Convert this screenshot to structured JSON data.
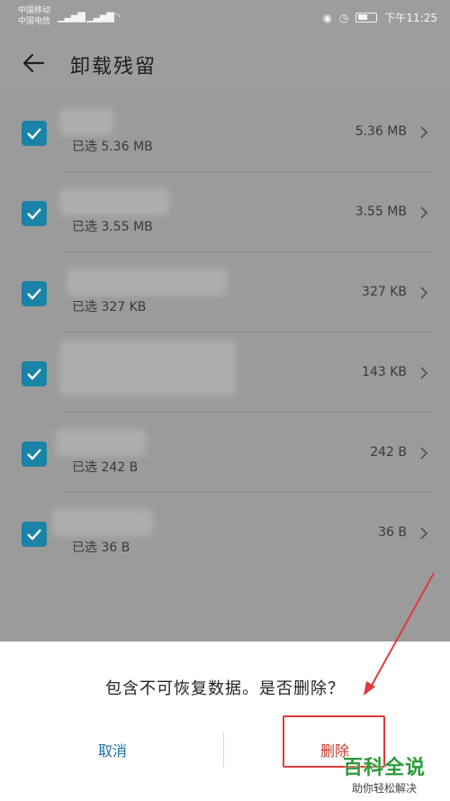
{
  "status_bar": {
    "carrier_1": "中国移动",
    "carrier_2": "中国电信",
    "time": "下午11:25"
  },
  "header": {
    "title": "卸载残留"
  },
  "items": [
    {
      "selected": "已选 5.36 MB",
      "size": "5.36 MB"
    },
    {
      "selected": "已选 3.55 MB",
      "size": "3.55 MB"
    },
    {
      "selected": "已选 327 KB",
      "size": "327 KB"
    },
    {
      "selected": "已选 143 KB",
      "size": "143 KB"
    },
    {
      "selected": "已选 242 B",
      "size": "242 B"
    },
    {
      "selected": "已选 36 B",
      "size": "36 B"
    }
  ],
  "dialog": {
    "message": "包含不可恢复数据。是否删除？",
    "cancel_label": "取消",
    "delete_label": "删除"
  },
  "watermark": {
    "main": "百科全说",
    "sub": "助你轻松解决"
  },
  "colors": {
    "accent": "#1b83a8",
    "annotation": "#e03a3a"
  }
}
